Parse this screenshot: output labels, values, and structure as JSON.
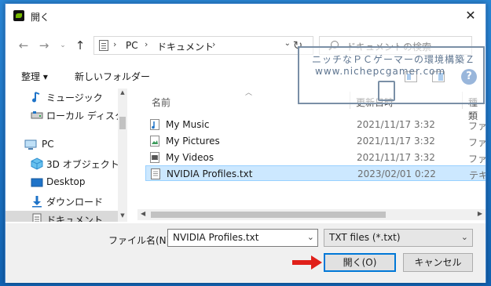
{
  "window": {
    "title": "開く"
  },
  "address": {
    "crumbs": [
      "PC",
      "ドキュメント"
    ],
    "separator": "›",
    "search_placeholder": "ドキュメントの検索"
  },
  "toolbar": {
    "organize": "整理 ▾",
    "new_folder": "新しいフォルダー",
    "help": "?"
  },
  "sidebar": {
    "items": [
      {
        "label": "ミュージック",
        "icon": "music-note-icon"
      },
      {
        "label": "ローカル ディスク (C",
        "icon": "drive-icon"
      },
      {
        "label": "PC",
        "icon": "computer-icon"
      },
      {
        "label": "3D オブジェクト",
        "icon": "cube-icon"
      },
      {
        "label": "Desktop",
        "icon": "desktop-icon"
      },
      {
        "label": "ダウンロード",
        "icon": "download-arrow-icon"
      },
      {
        "label": "ドキュメント",
        "icon": "document-icon"
      }
    ]
  },
  "file_list": {
    "columns": {
      "name": "名前",
      "date": "更新日時",
      "type": "種類"
    },
    "rows": [
      {
        "name": "My Music",
        "date": "2021/11/17 3:32",
        "type": "ファイル"
      },
      {
        "name": "My Pictures",
        "date": "2021/11/17 3:32",
        "type": "ファイル"
      },
      {
        "name": "My Videos",
        "date": "2021/11/17 3:32",
        "type": "ファイル"
      },
      {
        "name": "NVIDIA Profiles.txt",
        "date": "2023/02/01 0:22",
        "type": "テキス"
      }
    ]
  },
  "footer": {
    "filename_label": "ファイル名(N):",
    "filename_value": "NVIDIA Profiles.txt",
    "filetype_value": "TXT files (*.txt)",
    "open_button": "開く(O)",
    "cancel_button": "キャンセル"
  },
  "watermark": {
    "line1": "ニッチなＰＣゲーマーの環境構築Ｚ",
    "line2": "www.nichepcgamer.com"
  },
  "colors": {
    "accent": "#0078d7",
    "selection": "#cce8ff",
    "arrow": "#e0201a"
  }
}
